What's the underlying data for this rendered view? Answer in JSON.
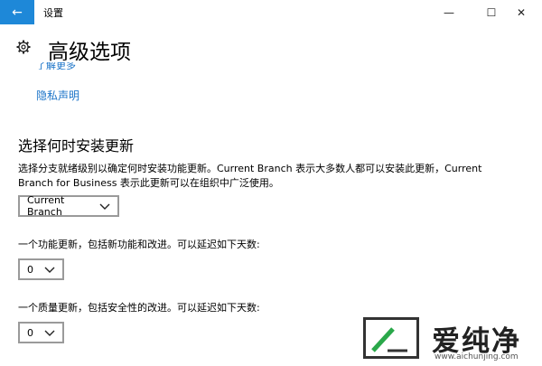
{
  "window": {
    "title": "设置",
    "back_glyph": "←",
    "minimize_glyph": "—",
    "maximize_glyph": "☐",
    "close_glyph": "✕"
  },
  "header": {
    "page_title": "高级选项",
    "gear_icon": "gear-icon",
    "partial_link": "了解更多",
    "privacy_link": "隐私声明"
  },
  "update_section": {
    "title": "选择何时安装更新",
    "description": "选择分支就绪级别以确定何时安装功能更新。Current Branch 表示大多数人都可以安装此更新，Current Branch for Business 表示此更新可以在组织中广泛使用。",
    "branch_select": {
      "value": "Current Branch",
      "icon": "chevron-down-icon"
    },
    "feature_label": "一个功能更新，包括新功能和改进。可以延迟如下天数:",
    "feature_select": {
      "value": "0",
      "icon": "chevron-down-icon"
    },
    "quality_label": "一个质量更新，包括安全性的改进。可以延迟如下天数:",
    "quality_select": {
      "value": "0",
      "icon": "chevron-down-icon"
    }
  },
  "watermark": {
    "brand": "爱纯净",
    "url": "www.aichunjing.com"
  },
  "colors": {
    "accent": "#1e88d8",
    "link": "#1a73c8",
    "border": "#9a9a9a"
  }
}
